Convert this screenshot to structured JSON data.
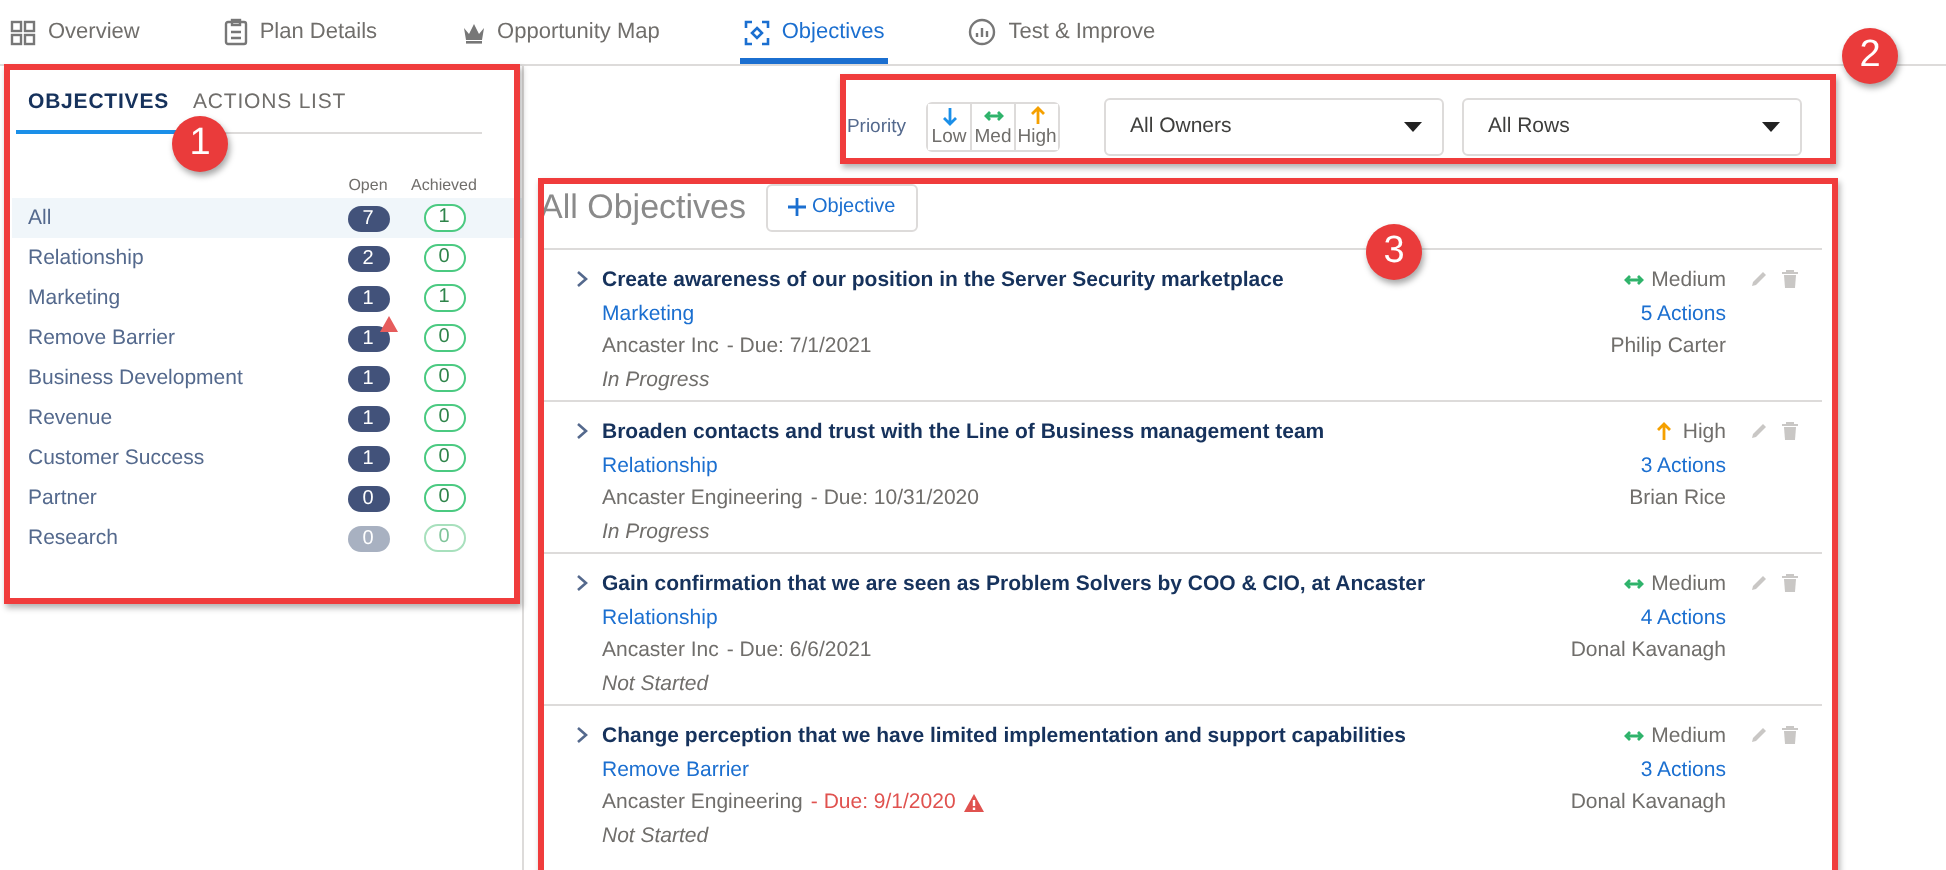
{
  "nav": {
    "tabs": [
      {
        "label": "Overview",
        "selected": false
      },
      {
        "label": "Plan Details",
        "selected": false
      },
      {
        "label": "Opportunity Map",
        "selected": false
      },
      {
        "label": "Objectives",
        "selected": true
      },
      {
        "label": "Test & Improve",
        "selected": false
      }
    ]
  },
  "sidebar": {
    "tabs": [
      {
        "label": "OBJECTIVES",
        "selected": true
      },
      {
        "label": "ACTIONS LIST",
        "selected": false
      }
    ],
    "columns": [
      "Open",
      "Achieved"
    ],
    "items": [
      {
        "label": "All",
        "open": "7",
        "achieved": "1",
        "selected": true,
        "disabled": false,
        "warning": false
      },
      {
        "label": "Relationship",
        "open": "2",
        "achieved": "0",
        "selected": false,
        "disabled": false,
        "warning": false
      },
      {
        "label": "Marketing",
        "open": "1",
        "achieved": "1",
        "selected": false,
        "disabled": false,
        "warning": false
      },
      {
        "label": "Remove Barrier",
        "open": "1",
        "achieved": "0",
        "selected": false,
        "disabled": false,
        "warning": true
      },
      {
        "label": "Business Development",
        "open": "1",
        "achieved": "0",
        "selected": false,
        "disabled": false,
        "warning": false
      },
      {
        "label": "Revenue",
        "open": "1",
        "achieved": "0",
        "selected": false,
        "disabled": false,
        "warning": false
      },
      {
        "label": "Customer Success",
        "open": "1",
        "achieved": "0",
        "selected": false,
        "disabled": false,
        "warning": false
      },
      {
        "label": "Partner",
        "open": "0",
        "achieved": "0",
        "selected": false,
        "disabled": false,
        "warning": false
      },
      {
        "label": "Research",
        "open": "0",
        "achieved": "0",
        "selected": false,
        "disabled": true,
        "warning": false
      }
    ]
  },
  "filters": {
    "priority_label": "Priority",
    "priority_buttons": [
      {
        "kind": "low",
        "label": "Low"
      },
      {
        "kind": "medium",
        "label": "Med"
      },
      {
        "kind": "high",
        "label": "High"
      }
    ],
    "owner_select": "All Owners",
    "rows_select": "All Rows"
  },
  "main": {
    "title": "All Objectives",
    "add_button": "Objective",
    "objectives": [
      {
        "title": "Create awareness of our position in the Server Security marketplace",
        "category": "Marketing",
        "account": "Ancaster Inc",
        "due": "- Due: 7/1/2021",
        "overdue": false,
        "status": "In Progress",
        "priority": {
          "kind": "medium",
          "label": "Medium"
        },
        "actions": "5 Actions",
        "owner": "Philip Carter"
      },
      {
        "title": "Broaden contacts and trust with the Line of Business management team",
        "category": "Relationship",
        "account": "Ancaster Engineering",
        "due": "- Due: 10/31/2020",
        "overdue": false,
        "status": "In Progress",
        "priority": {
          "kind": "high",
          "label": "High"
        },
        "actions": "3 Actions",
        "owner": "Brian Rice"
      },
      {
        "title": "Gain confirmation that we are seen as Problem Solvers by COO & CIO, at Ancaster",
        "category": "Relationship",
        "account": "Ancaster Inc",
        "due": "- Due: 6/6/2021",
        "overdue": false,
        "status": "Not Started",
        "priority": {
          "kind": "medium",
          "label": "Medium"
        },
        "actions": "4 Actions",
        "owner": "Donal Kavanagh"
      },
      {
        "title": "Change perception that we have limited implementation and support capabilities",
        "category": "Remove Barrier",
        "account": "Ancaster Engineering",
        "due": "- Due: 9/1/2020",
        "overdue": true,
        "status": "Not Started",
        "priority": {
          "kind": "medium",
          "label": "Medium"
        },
        "actions": "3 Actions",
        "owner": "Donal Kavanagh"
      }
    ]
  },
  "annotations": [
    "1",
    "2",
    "3"
  ]
}
